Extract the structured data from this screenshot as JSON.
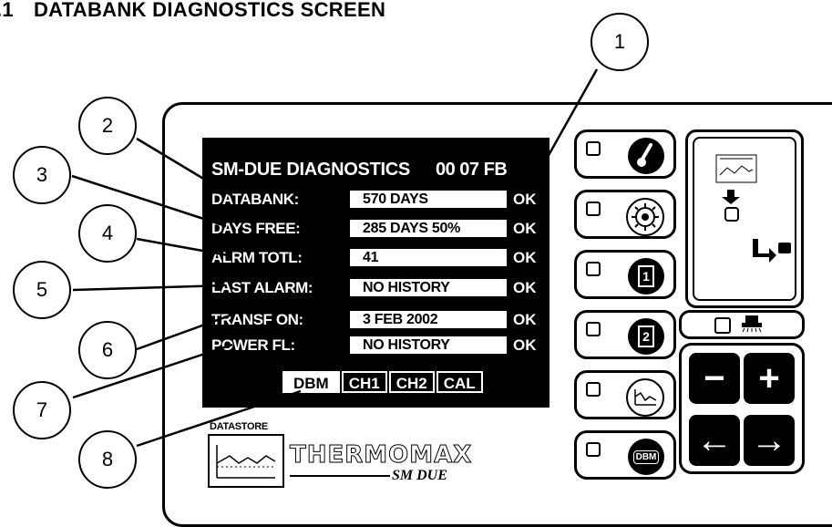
{
  "title": {
    "number": ".1",
    "text": "DATABANK DIAGNOSTICS SCREEN"
  },
  "lcd": {
    "heading": "SM-DUE DIAGNOSTICS",
    "code": "00 07 FB",
    "rows": [
      {
        "label": "DATABANK:",
        "value": "570 DAYS",
        "status": "OK"
      },
      {
        "label": "DAYS FREE:",
        "value": "285 DAYS  50%",
        "status": "OK"
      },
      {
        "label": "ALRM TOTL:",
        "value": "41",
        "status": "OK"
      },
      {
        "label": "LAST ALARM:",
        "value": "NO HISTORY",
        "status": "OK"
      },
      {
        "label": "TRANSF ON:",
        "value": "3  FEB  2002",
        "status": "OK"
      },
      {
        "label": "POWER FL:",
        "value": "NO HISTORY",
        "status": "OK"
      }
    ],
    "tabs": [
      "DBM",
      "CH1",
      "CH2",
      "CAL"
    ],
    "active_tab": "DBM"
  },
  "logo": {
    "datastore": "DATASTORE",
    "brand": "THERMOMAX",
    "model": "SM DUE"
  },
  "side_buttons": [
    {
      "icon": "thermometer-icon"
    },
    {
      "icon": "sensor-dial-icon"
    },
    {
      "icon": "channel-1-icon",
      "badge": "1"
    },
    {
      "icon": "channel-2-icon",
      "badge": "2"
    },
    {
      "icon": "graph-icon"
    },
    {
      "icon": "dbm-icon",
      "badge": "DBM"
    }
  ],
  "keypad": {
    "minus": "−",
    "plus": "+",
    "left": "←",
    "right": "→"
  },
  "callouts": [
    "1",
    "2",
    "3",
    "4",
    "5",
    "6",
    "7",
    "8"
  ]
}
